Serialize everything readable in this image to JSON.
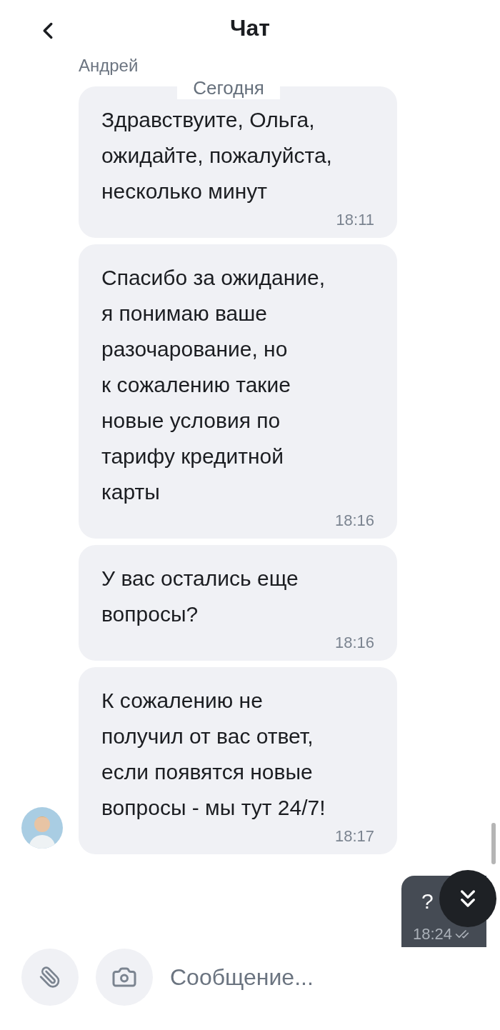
{
  "header": {
    "title": "Чат"
  },
  "sender": {
    "name": "Андрей"
  },
  "date_chip": "Сегодня",
  "messages": [
    {
      "text": "Здравствуите, Ольга,\nожидайте, пожалуйста,\nнесколько минут",
      "time": "18:11"
    },
    {
      "text": "Спасибо за ожидание,\nя понимаю ваше\nразочарование, но\nк сожалению такие\nновые условия по\nтарифу кредитной\nкарты",
      "time": "18:16"
    },
    {
      "text": "У вас остались еще\nвопросы?",
      "time": "18:16"
    },
    {
      "text": "К сожалению не\nполучил от вас ответ,\nесли появятся новые\nвопросы - мы тут 24/7!",
      "time": "18:17"
    }
  ],
  "outgoing": {
    "text": "?",
    "time": "18:24",
    "read": true
  },
  "composer": {
    "placeholder": "Сообщение..."
  }
}
